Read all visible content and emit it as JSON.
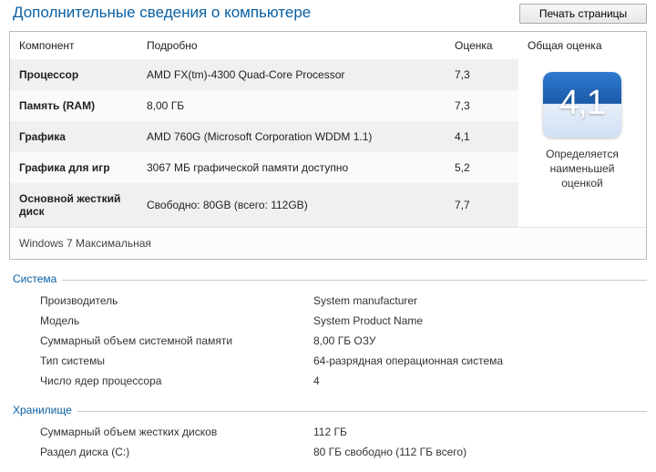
{
  "header": {
    "title": "Дополнительные сведения о компьютере",
    "print_button": "Печать страницы"
  },
  "table": {
    "headers": {
      "component": "Компонент",
      "detail": "Подробно",
      "score": "Оценка",
      "overall": "Общая оценка"
    },
    "rows": [
      {
        "label": "Процессор",
        "detail": "AMD FX(tm)-4300 Quad-Core Processor",
        "score": "7,3"
      },
      {
        "label": "Память (RAM)",
        "detail": "8,00 ГБ",
        "score": "7,3"
      },
      {
        "label": "Графика",
        "detail": "AMD 760G (Microsoft Corporation WDDM 1.1)",
        "score": "4,1"
      },
      {
        "label": "Графика для игр",
        "detail": "3067 МБ графической памяти доступно",
        "score": "5,2"
      },
      {
        "label": "Основной жесткий диск",
        "detail": "Свободно: 80GB (всего: 112GB)",
        "score": "7,7"
      }
    ],
    "overall_score": "4,1",
    "overall_caption": "Определяется наименьшей оценкой",
    "os_line": "Windows 7 Максимальная"
  },
  "system": {
    "title": "Система",
    "rows": [
      {
        "k": "Производитель",
        "v": "System manufacturer"
      },
      {
        "k": "Модель",
        "v": "System Product Name"
      },
      {
        "k": "Суммарный объем системной памяти",
        "v": "8,00 ГБ ОЗУ"
      },
      {
        "k": "Тип системы",
        "v": "64-разрядная операционная система"
      },
      {
        "k": "Число ядер процессора",
        "v": "4"
      }
    ]
  },
  "storage": {
    "title": "Хранилище",
    "rows": [
      {
        "k": "Суммарный объем жестких дисков",
        "v": "112 ГБ"
      },
      {
        "k": "Раздел диска (C:)",
        "v": "80 ГБ свободно (112 ГБ всего)"
      }
    ]
  }
}
